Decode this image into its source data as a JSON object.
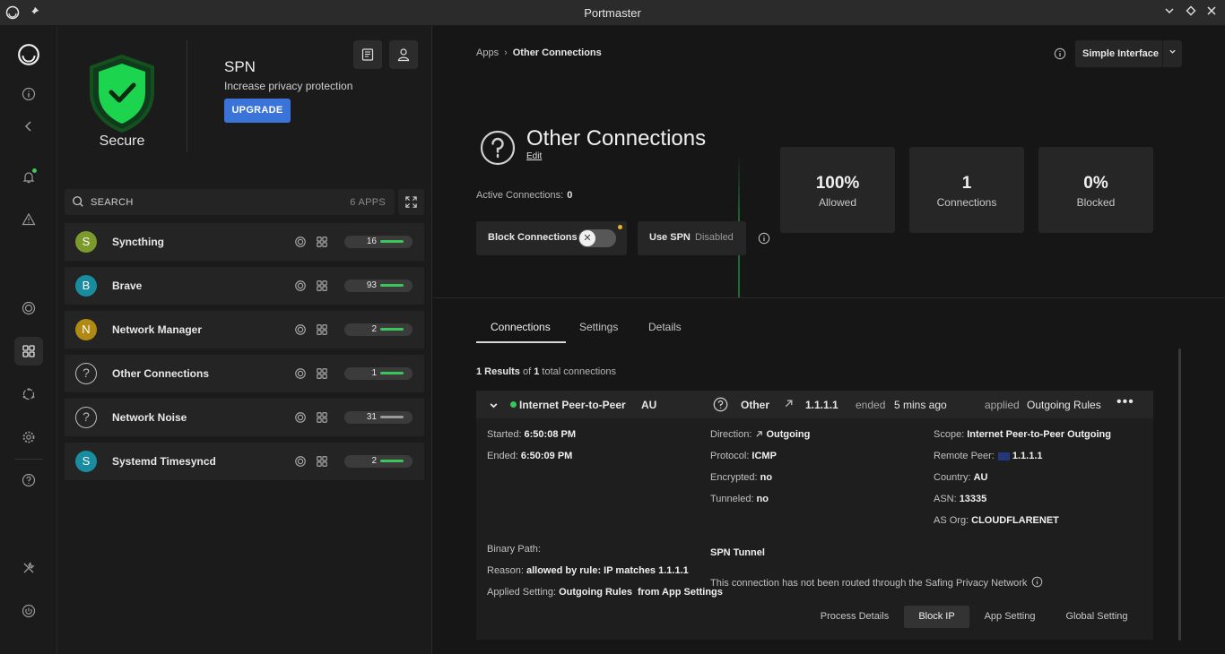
{
  "window": {
    "title": "Portmaster"
  },
  "spn_panel": {
    "status_label": "Secure",
    "title": "SPN",
    "subtitle": "Increase privacy protection",
    "upgrade_label": "UPGRADE"
  },
  "search": {
    "placeholder": "SEARCH",
    "count": "6 APPS"
  },
  "apps": [
    {
      "initial": "S",
      "name": "Syncthing",
      "count": "16",
      "color": "#7c9a2c",
      "bar": "green"
    },
    {
      "initial": "B",
      "name": "Brave",
      "count": "93",
      "color": "#1a8ca0",
      "bar": "green"
    },
    {
      "initial": "N",
      "name": "Network Manager",
      "count": "2",
      "color": "#b08a12",
      "bar": "green"
    },
    {
      "initial": "?",
      "name": "Other Connections",
      "count": "1",
      "color": "",
      "bar": "green"
    },
    {
      "initial": "?",
      "name": "Network Noise",
      "count": "31",
      "color": "",
      "bar": "gray"
    },
    {
      "initial": "S",
      "name": "Systemd Timesyncd",
      "count": "2",
      "color": "#1a8ca0",
      "bar": "green"
    }
  ],
  "breadcrumb": {
    "parent": "Apps",
    "current": "Other Connections"
  },
  "interface_select": {
    "value": "Simple Interface"
  },
  "app_header": {
    "title": "Other Connections",
    "edit_label": "Edit",
    "active_connections_label": "Active Connections:",
    "active_connections_value": "0"
  },
  "controls": {
    "block_label": "Block Connections",
    "spn_label": "Use SPN",
    "spn_value": "Disabled"
  },
  "stats": [
    {
      "value": "100%",
      "label": "Allowed"
    },
    {
      "value": "1",
      "label": "Connections"
    },
    {
      "value": "0%",
      "label": "Blocked"
    }
  ],
  "tabs": [
    "Connections",
    "Settings",
    "Details"
  ],
  "results": {
    "prefix": "1 Results",
    "middle": "of",
    "total": "1",
    "suffix": "total connections"
  },
  "connection": {
    "scope_short": "Internet Peer-to-Peer (",
    "country": "AU",
    "app": "Other",
    "ip": "1.1.1.1",
    "ended_label": "ended",
    "ended_value": "5 mins ago",
    "applied_label": "applied",
    "applied_value": "Outgoing Rules",
    "details": {
      "started_label": "Started:",
      "started": "6:50:08 PM",
      "ended_label": "Ended:",
      "ended": "6:50:09 PM",
      "direction_label": "Direction:",
      "direction": "Outgoing",
      "protocol_label": "Protocol:",
      "protocol": "ICMP",
      "encrypted_label": "Encrypted:",
      "encrypted": "no",
      "tunneled_label": "Tunneled:",
      "tunneled": "no",
      "scope_label": "Scope:",
      "scope": "Internet Peer-to-Peer Outgoing",
      "remote_label": "Remote Peer:",
      "remote": "1.1.1.1",
      "country_label": "Country:",
      "country": "AU",
      "asn_label": "ASN:",
      "asn": "13335",
      "asorg_label": "AS Org:",
      "asorg": "CLOUDFLARENET",
      "binary_label": "Binary Path:",
      "reason_label": "Reason:",
      "reason": "allowed by rule: IP matches 1.1.1.1",
      "applied_label": "Applied Setting:",
      "applied": "Outgoing Rules",
      "applied_from": "from App Settings",
      "spn_title": "SPN Tunnel",
      "spn_text": "This connection has not been routed through the Safing Privacy Network"
    },
    "actions": [
      "Process Details",
      "Block IP",
      "App Setting",
      "Global Setting"
    ]
  },
  "colors": {
    "accent_green": "#3ac65b",
    "accent_blue": "#3a74d8",
    "warning_yellow": "#e6b525"
  }
}
